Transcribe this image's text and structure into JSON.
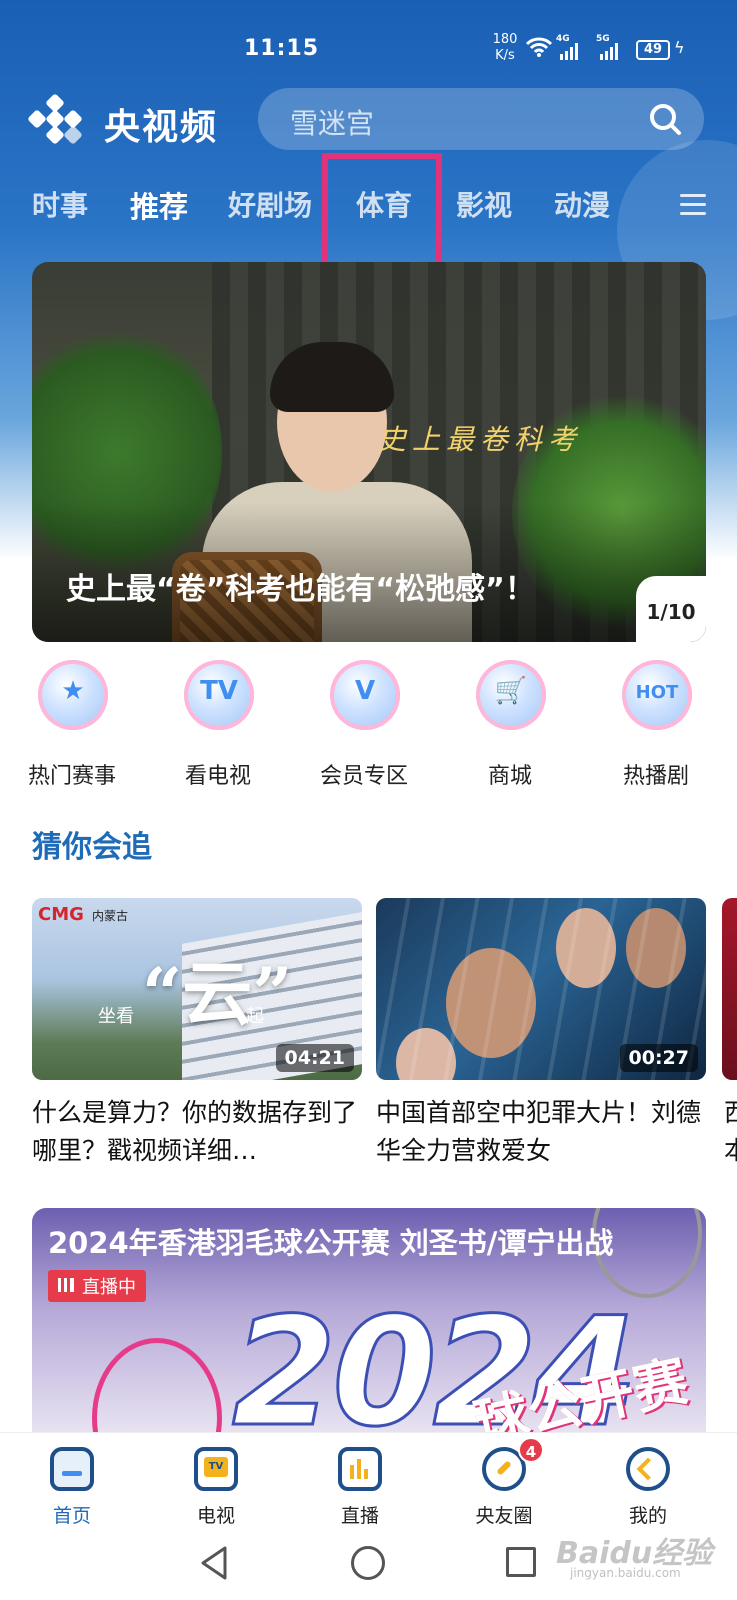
{
  "status_bar": {
    "time": "11:15",
    "net_speed_value": "180",
    "net_speed_unit": "K/s",
    "network1": "4G",
    "network2": "5G",
    "battery": "49"
  },
  "header": {
    "app_title": "央视频",
    "search_placeholder": "雪迷宫"
  },
  "tabs": [
    {
      "label": "时事"
    },
    {
      "label": "推荐"
    },
    {
      "label": "好剧场"
    },
    {
      "label": "体育"
    },
    {
      "label": "影视"
    },
    {
      "label": "动漫"
    }
  ],
  "banner": {
    "overlay_text": "史上最卷科考",
    "title": "史上最“卷”科考也能有“松弛感”！",
    "counter": "1/10"
  },
  "shortcuts": [
    {
      "label": "热门赛事",
      "icon": "trophy-icon",
      "glyph": "★"
    },
    {
      "label": "看电视",
      "icon": "tv-icon",
      "glyph": "TV"
    },
    {
      "label": "会员专区",
      "icon": "vip-icon",
      "glyph": "V"
    },
    {
      "label": "商城",
      "icon": "cart-icon",
      "glyph": "🛒"
    },
    {
      "label": "热播剧",
      "icon": "hot-icon",
      "glyph": "HOT"
    }
  ],
  "recommend": {
    "section_title": "猜你会追",
    "cards": [
      {
        "title": "什么是算力？你的数据存到了哪里？戳视频详细…",
        "duration": "04:21",
        "logo": "CMG",
        "region": "内蒙古",
        "big_char": "“云”",
        "left_word": "坐看",
        "right_word": "起"
      },
      {
        "title": "中国首部空中犯罪大片！刘德华全力营救爱女",
        "duration": "00:27"
      }
    ],
    "peek_text": "西本"
  },
  "live": {
    "title": "2024年香港羽毛球公开赛 刘圣书/谭宁出战",
    "badge": "直播中",
    "big_text": "2024",
    "sub_text": "球公开赛"
  },
  "bottom_nav": [
    {
      "label": "首页",
      "active": true
    },
    {
      "label": "电视"
    },
    {
      "label": "直播"
    },
    {
      "label": "央友圈",
      "badge": "4"
    },
    {
      "label": "我的"
    }
  ],
  "watermark": {
    "text": "Baidu经验",
    "sub": "jingyan.baidu.com"
  },
  "colors": {
    "accent": "#1f6bb8",
    "highlight": "#e0337a",
    "live_red": "#e63b4a"
  }
}
